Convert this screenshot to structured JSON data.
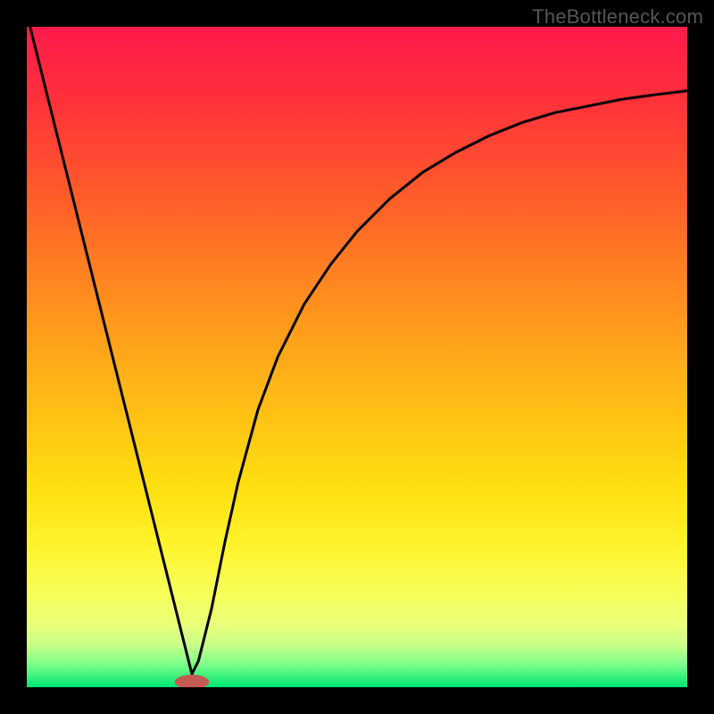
{
  "watermark": "TheBottleneck.com",
  "chart_data": {
    "type": "line",
    "title": "",
    "xlabel": "",
    "ylabel": "",
    "xlim": [
      0,
      100
    ],
    "ylim": [
      0,
      100
    ],
    "grid": false,
    "legend": false,
    "gradient_stops": [
      {
        "offset": 0.0,
        "color": "#ff1a4b"
      },
      {
        "offset": 0.1,
        "color": "#ff2e3c"
      },
      {
        "offset": 0.25,
        "color": "#ff5a2a"
      },
      {
        "offset": 0.4,
        "color": "#ff8a1f"
      },
      {
        "offset": 0.55,
        "color": "#ffb716"
      },
      {
        "offset": 0.7,
        "color": "#ffe010"
      },
      {
        "offset": 0.78,
        "color": "#fff22a"
      },
      {
        "offset": 0.86,
        "color": "#f6ff5a"
      },
      {
        "offset": 0.905,
        "color": "#eaff7a"
      },
      {
        "offset": 0.935,
        "color": "#c9ff88"
      },
      {
        "offset": 0.965,
        "color": "#7eff8a"
      },
      {
        "offset": 1.0,
        "color": "#00e673"
      }
    ],
    "series": [
      {
        "name": "bottleneck-curve",
        "color": "#000000",
        "x": [
          0,
          2,
          4,
          6,
          8,
          10,
          12,
          14,
          16,
          18,
          20,
          22,
          24,
          25,
          26,
          28,
          30,
          32,
          35,
          38,
          42,
          46,
          50,
          55,
          60,
          65,
          70,
          75,
          80,
          85,
          90,
          95,
          100
        ],
        "y": [
          102,
          94,
          86,
          78,
          70,
          62,
          54,
          46,
          38,
          30,
          22,
          14,
          6,
          2,
          4,
          12,
          22,
          31,
          42,
          50,
          58,
          64,
          69,
          74,
          78,
          81,
          83.5,
          85.5,
          87,
          88,
          89,
          89.7,
          90.3
        ]
      }
    ],
    "minimum_marker": {
      "x": 25,
      "y": 0.8,
      "rx": 2.6,
      "ry": 1.1,
      "color": "#c45a52"
    }
  }
}
